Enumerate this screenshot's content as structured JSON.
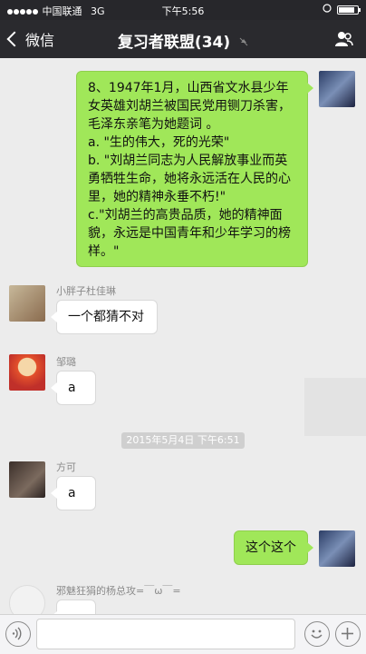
{
  "status_bar": {
    "carrier": "中国联通",
    "network": "3G",
    "time": "下午5:56"
  },
  "nav": {
    "back_label": "微信",
    "title": "复习者联盟(34)",
    "muted_icon": "mute-icon",
    "right_icon": "group-members-icon"
  },
  "messages": [
    {
      "sender": "me",
      "text": "8、1947年1月，山西省文水县少年女英雄刘胡兰被国民党用铡刀杀害，毛泽东亲笔为她题词 。\na. \"生的伟大，死的光荣\"\nb. \"刘胡兰同志为人民解放事业而英勇牺牲生命，她将永远活在人民的心里，她的精神永垂不朽!\"\nc.\"刘胡兰的高贵品质，她的精神面貌，永远是中国青年和少年学习的榜样。\""
    },
    {
      "sender": "小胖子杜佳琳",
      "text": "一个都猜不对"
    },
    {
      "sender": "邹璐",
      "text": "a"
    },
    {
      "sender": "方可",
      "text": "a"
    },
    {
      "sender": "me",
      "text": "这个这个"
    },
    {
      "sender": "邪魅狂狷的杨总攻=￣ω￣=",
      "text": ""
    }
  ],
  "timestamp": "2015年5月4日 下午6:51",
  "input_bar": {
    "voice_icon": "voice-icon",
    "emoji_icon": "emoji-icon",
    "plus_icon": "plus-icon"
  },
  "colors": {
    "nav_bg": "#2a2a2e",
    "chat_bg": "#ececec",
    "out_bubble": "#a0e759",
    "in_bubble": "#ffffff"
  }
}
